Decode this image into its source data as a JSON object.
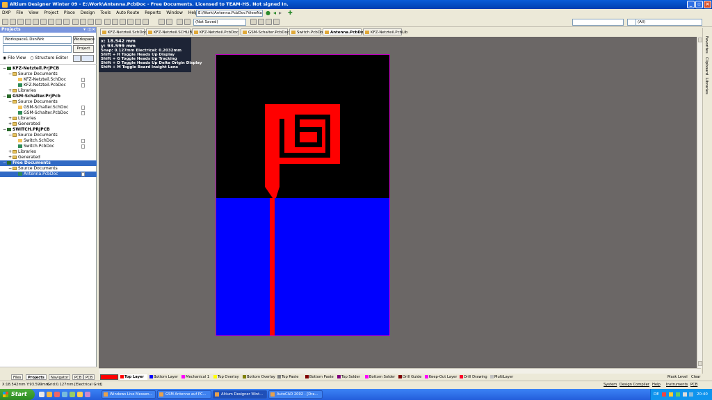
{
  "window": {
    "title": "Altium Designer Winter 09 - E:\\Work\\Antenna.PcbDoc - Free Documents. Licensed to TEAM-HS. Not signed In."
  },
  "menu": [
    "DXP",
    "File",
    "View",
    "Project",
    "Place",
    "Design",
    "Tools",
    "Auto Route",
    "Reports",
    "Window",
    "Help"
  ],
  "address": "E:\\Work\\Antenna.PcbDoc?ViewName=",
  "toolbar": {
    "save_state": "(Not Saved)",
    "filter_all": "(All)"
  },
  "panel": {
    "title": "Projects",
    "workspace_value": "Workspace1.DsnWrk",
    "workspace_button": "Workspace",
    "project_button": "Project",
    "radio_file_view": "File View",
    "radio_structure_editor": "Structure Editor",
    "tree": [
      {
        "label": "KFZ-Netzteil.PrjPCB",
        "level": 0,
        "type": "proj"
      },
      {
        "label": "Source Documents",
        "level": 1,
        "type": "folder"
      },
      {
        "label": "KFZ-Netzteil.SchDoc",
        "level": 2,
        "type": "sch"
      },
      {
        "label": "KFZ-Netzteil.PcbDoc",
        "level": 2,
        "type": "pcb"
      },
      {
        "label": "Libraries",
        "level": 1,
        "type": "folder"
      },
      {
        "label": "GSM-Schalter.PrjPcb",
        "level": 0,
        "type": "proj"
      },
      {
        "label": "Source Documents",
        "level": 1,
        "type": "folder"
      },
      {
        "label": "GSM-Schalter.SchDoc",
        "level": 2,
        "type": "sch"
      },
      {
        "label": "GSM-Schalter.PcbDoc",
        "level": 2,
        "type": "pcb"
      },
      {
        "label": "Libraries",
        "level": 1,
        "type": "folder"
      },
      {
        "label": "Generated",
        "level": 1,
        "type": "folder"
      },
      {
        "label": "SWITCH.PRJPCB",
        "level": 0,
        "type": "proj"
      },
      {
        "label": "Source Documents",
        "level": 1,
        "type": "folder"
      },
      {
        "label": "Switch.SchDoc",
        "level": 2,
        "type": "sch"
      },
      {
        "label": "Switch.PcbDoc",
        "level": 2,
        "type": "pcb"
      },
      {
        "label": "Libraries",
        "level": 1,
        "type": "folder"
      },
      {
        "label": "Generated",
        "level": 1,
        "type": "folder"
      },
      {
        "label": "Free Documents",
        "level": 0,
        "type": "proj",
        "selected": true
      },
      {
        "label": "Source Documents",
        "level": 1,
        "type": "folder"
      },
      {
        "label": "Antenna.PcbDoc",
        "level": 2,
        "type": "pcb",
        "selected": true
      }
    ]
  },
  "doc_tabs": [
    "KFZ-Netzteil.SchDoc",
    "KFZ-Netzteil.SCHLIB",
    "KFZ-Netzteil.PcbDoc",
    "GSM-Schalter.PcbDoc",
    "Switch.PcbDoc",
    "Antenna.PcbDoc",
    "KFZ-Netzteil.PcbLib"
  ],
  "active_doc_tab": 5,
  "hud": {
    "x": "x: 18.542  mm",
    "y": "y: 93.599  mm",
    "snap": "Snap: 0.127mm Electrical: 0.2032mm",
    "lines": [
      "Shift + H   Toggle Heads Up Display",
      "Shift + G   Toggle Heads Up Tracking",
      "Shift + D   Toggle Heads Up Delta Origin Display",
      "Shift + M   Toggle Board Insight Lens"
    ]
  },
  "colors": {
    "board_bg": "#000000",
    "bottom_layer": "#0000ff",
    "top_layer": "#ff0000",
    "board_outline": "#c000c0",
    "workspace": "#6b6766"
  },
  "right_panels": [
    "Favorites",
    "Clipboard",
    "Libraries"
  ],
  "layers": [
    {
      "name": "Top Layer",
      "color": "#ff0000",
      "active": true
    },
    {
      "name": "Bottom Layer",
      "color": "#0000ff"
    },
    {
      "name": "Mechanical 1",
      "color": "#ff00ff"
    },
    {
      "name": "Top Overlay",
      "color": "#ffff00"
    },
    {
      "name": "Bottom Overlay",
      "color": "#808000"
    },
    {
      "name": "Top Paste",
      "color": "#808080"
    },
    {
      "name": "Bottom Paste",
      "color": "#800000"
    },
    {
      "name": "Top Solder",
      "color": "#800080"
    },
    {
      "name": "Bottom Solder",
      "color": "#ff00ff"
    },
    {
      "name": "Drill Guide",
      "color": "#800000"
    },
    {
      "name": "Keep-Out Layer",
      "color": "#ff00ff"
    },
    {
      "name": "Drill Drawing",
      "color": "#ff002a"
    },
    {
      "name": "MultiLayer",
      "color": "#c0c0c0"
    }
  ],
  "layer_right": {
    "mask": "Mask Level",
    "clear": "Clear"
  },
  "bottom_tabs": [
    "Files",
    "Projects",
    "Navigator",
    "PCB",
    "PCB"
  ],
  "status": {
    "coords": "X:18.542mm Y:93.599mm",
    "grid": "Grid:0.127mm",
    "electrical": "[Electrical Grid]",
    "right": [
      "System",
      "Design Compiler",
      "Help",
      "Instruments",
      "PCB"
    ]
  },
  "taskbar": {
    "start": "Start",
    "tasks": [
      "Windows Live Messen...",
      "GSM Antenne auf PC...",
      "Altium Designer Wint...",
      "AutoCAD 2002 - [Dra..."
    ],
    "active_task": 2,
    "lang": "DE",
    "time": "20:40"
  }
}
